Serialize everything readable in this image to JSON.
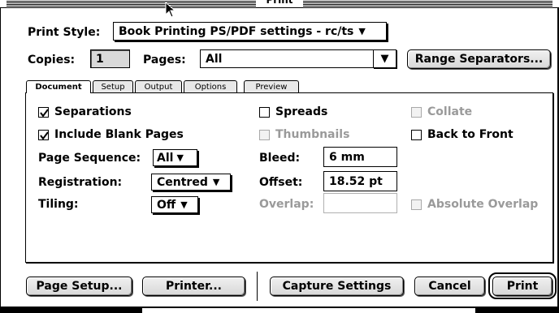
{
  "window": {
    "title": "Print"
  },
  "print_style": {
    "label": "Print Style:",
    "value": "Book Printing PS/PDF settings - rc/ts"
  },
  "copies": {
    "label": "Copies:",
    "value": "1"
  },
  "pages": {
    "label": "Pages:",
    "value": "All"
  },
  "range_separators_button": "Range Separators...",
  "tabs": [
    {
      "label": "Document",
      "active": true
    },
    {
      "label": "Setup",
      "active": false
    },
    {
      "label": "Output",
      "active": false
    },
    {
      "label": "Options",
      "active": false
    },
    {
      "label": "Preview",
      "active": false
    }
  ],
  "document": {
    "separations": {
      "label": "Separations",
      "checked": true
    },
    "include_blank_pages": {
      "label": "Include Blank Pages",
      "checked": true
    },
    "spreads": {
      "label": "Spreads",
      "checked": false
    },
    "thumbnails": {
      "label": "Thumbnails",
      "checked": false,
      "enabled": false
    },
    "collate": {
      "label": "Collate",
      "checked": false,
      "enabled": false
    },
    "back_to_front": {
      "label": "Back to Front",
      "checked": false
    },
    "page_sequence": {
      "label": "Page Sequence:",
      "value": "All"
    },
    "registration": {
      "label": "Registration:",
      "value": "Centred"
    },
    "tiling": {
      "label": "Tiling:",
      "value": "Off"
    },
    "bleed": {
      "label": "Bleed:",
      "value": "6  mm"
    },
    "offset": {
      "label": "Offset:",
      "value": "18.52  pt"
    },
    "overlap": {
      "label": "Overlap:",
      "value": "",
      "enabled": false
    },
    "absolute_overlap": {
      "label": "Absolute Overlap",
      "checked": false,
      "enabled": false
    }
  },
  "buttons": {
    "page_setup": "Page Setup...",
    "printer": "Printer...",
    "capture_settings": "Capture Settings",
    "cancel": "Cancel",
    "print": "Print"
  },
  "icons": {
    "dropdown": "triangle-down-icon",
    "check": "checkmark-icon",
    "cursor": "arrow-cursor-icon"
  }
}
